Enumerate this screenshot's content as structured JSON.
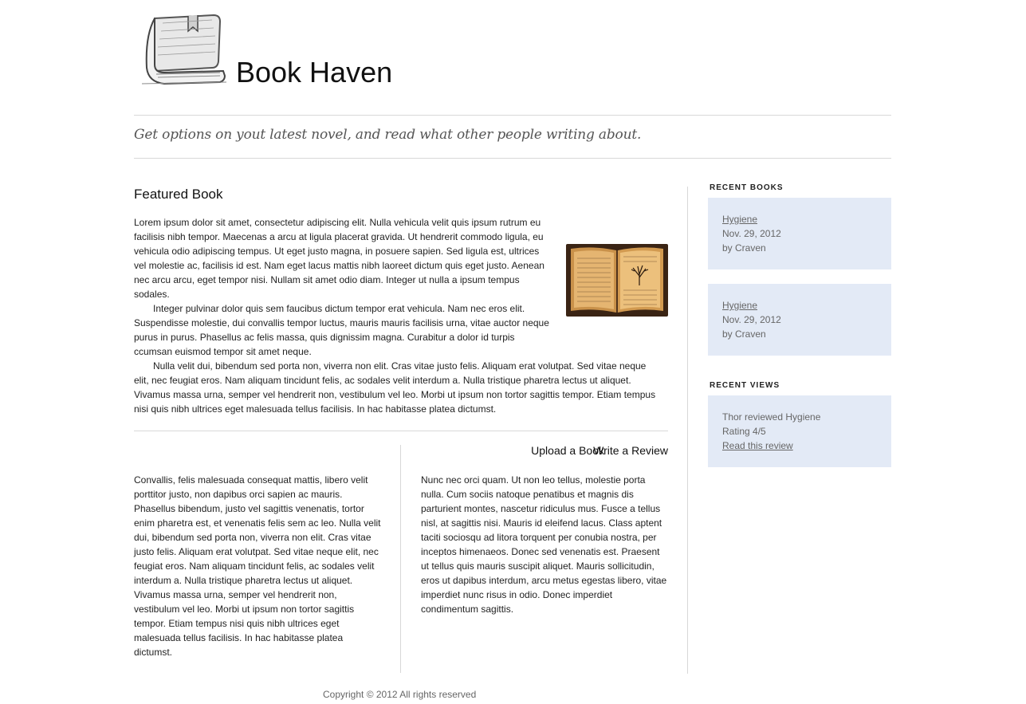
{
  "header": {
    "site_title": "Book Haven",
    "tagline": "Get options on yout latest novel, and read what other people writing about."
  },
  "featured": {
    "title": "Featured Book",
    "paragraphs": [
      "Lorem ipsum dolor sit amet, consectetur adipiscing elit. Nulla vehicula velit quis ipsum rutrum eu facilisis nibh tempor. Maecenas a arcu at ligula placerat gravida. Ut hendrerit commodo ligula, eu vehicula odio adipiscing tempus. Ut eget justo magna, in posuere sapien. Sed ligula est, ultrices vel molestie ac, facilisis id est. Nam eget lacus mattis nibh laoreet dictum quis eget justo. Aenean nec arcu arcu, eget tempor nisi. Nullam sit amet odio diam. Integer ut nulla a ipsum tempus sodales.",
      "Integer pulvinar dolor quis sem faucibus dictum tempor erat vehicula. Nam nec eros elit. Suspendisse molestie, dui convallis tempor luctus, mauris mauris facilisis urna, vitae auctor neque purus in purus. Phasellus ac felis massa, quis dignissim magna. Curabitur a dolor id turpis ccumsan euismod tempor sit amet neque.",
      "Nulla velit dui, bibendum sed porta non, viverra non elit. Cras vitae justo felis. Aliquam erat volutpat. Sed vitae neque elit, nec feugiat eros. Nam aliquam tincidunt felis, ac sodales velit interdum a. Nulla tristique pharetra lectus ut aliquet. Vivamus massa urna, semper vel hendrerit non, vestibulum vel leo. Morbi ut ipsum non tortor sagittis tempor. Etiam tempus nisi quis nibh ultrices eget malesuada tellus facilisis. In hac habitasse platea dictumst."
    ]
  },
  "upload": {
    "title": "Upload a Book",
    "text": "Convallis, felis malesuada consequat mattis, libero velit porttitor justo, non dapibus orci sapien ac mauris. Phasellus bibendum, justo vel sagittis venenatis, tortor enim pharetra est, et venenatis felis sem ac leo. Nulla velit dui, bibendum sed porta non, viverra non elit. Cras vitae justo felis. Aliquam erat volutpat. Sed vitae neque elit, nec feugiat eros. Nam aliquam tincidunt felis, ac sodales velit interdum a. Nulla tristique pharetra lectus ut aliquet. Vivamus massa urna, semper vel hendrerit non, vestibulum vel leo. Morbi ut ipsum non tortor sagittis tempor. Etiam tempus nisi quis nibh ultrices eget malesuada tellus facilisis. In hac habitasse platea dictumst."
  },
  "review": {
    "title": "Write a Review",
    "text": "Nunc nec orci quam. Ut non leo tellus, molestie porta nulla. Cum sociis natoque penatibus et magnis dis parturient montes, nascetur ridiculus mus. Fusce a tellus nisl, at sagittis nisi. Mauris id eleifend lacus. Class aptent taciti sociosqu ad litora torquent per conubia nostra, per inceptos himenaeos. Donec sed venenatis est. Praesent ut tellus quis mauris suscipit aliquet. Mauris sollicitudin, eros ut dapibus interdum, arcu metus egestas libero, vitae imperdiet nunc risus in odio. Donec imperdiet condimentum sagittis."
  },
  "sidebar": {
    "recent_books_heading": "RECENT BOOKS",
    "recent_books": [
      {
        "title": "Hygiene",
        "date": "Nov. 29, 2012",
        "author": "by Craven"
      },
      {
        "title": "Hygiene",
        "date": "Nov. 29, 2012",
        "author": "by Craven"
      }
    ],
    "recent_views_heading": "RECENT VIEWS",
    "recent_view": {
      "text": "Thor reviewed Hygiene",
      "rating": "Rating 4/5",
      "link": "Read this review"
    },
    "card_color": "#e3eaf6"
  },
  "footer": {
    "copyright": "Copyright © 2012 All rights reserved"
  }
}
